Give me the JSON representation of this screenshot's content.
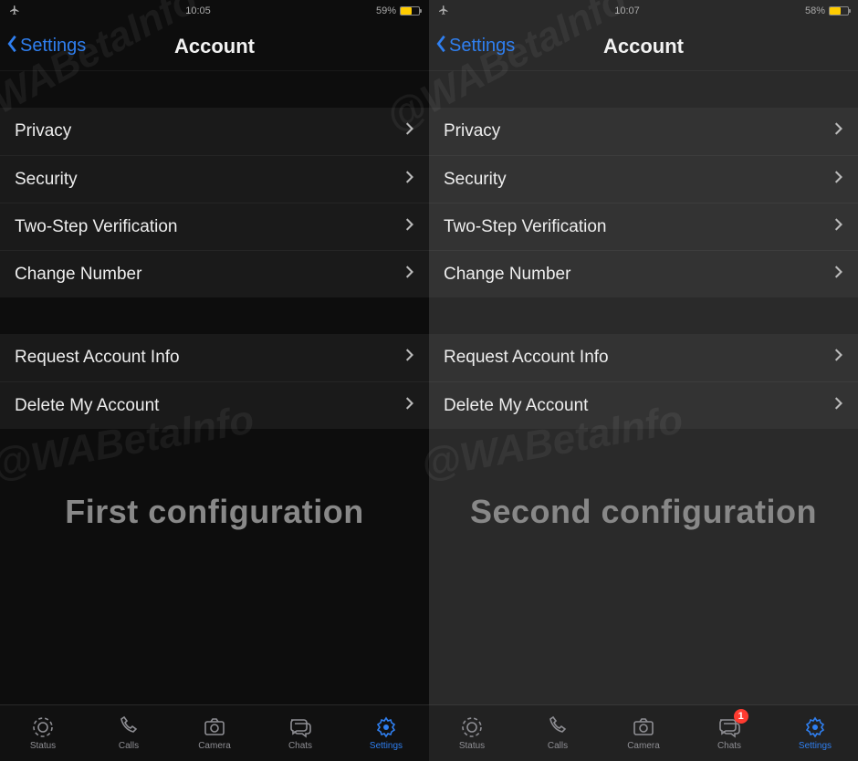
{
  "watermark": "@WABetaInfo",
  "screens": [
    {
      "bgClass": "bg-dark",
      "status": {
        "time": "10:05",
        "battery_pct": "59%",
        "battery_fill": "59%"
      },
      "nav": {
        "back": "Settings",
        "title": "Account"
      },
      "group1": [
        {
          "label": "Privacy"
        },
        {
          "label": "Security"
        },
        {
          "label": "Two-Step Verification"
        },
        {
          "label": "Change Number"
        }
      ],
      "group2": [
        {
          "label": "Request Account Info"
        },
        {
          "label": "Delete My Account"
        }
      ],
      "caption": "First configuration",
      "tabs": [
        {
          "name": "status",
          "label": "Status",
          "icon": "status-icon",
          "active": false,
          "badge": null
        },
        {
          "name": "calls",
          "label": "Calls",
          "icon": "phone-icon",
          "active": false,
          "badge": null
        },
        {
          "name": "camera",
          "label": "Camera",
          "icon": "camera-icon",
          "active": false,
          "badge": null
        },
        {
          "name": "chats",
          "label": "Chats",
          "icon": "chats-icon",
          "active": false,
          "badge": null
        },
        {
          "name": "settings",
          "label": "Settings",
          "icon": "settings-icon",
          "active": true,
          "badge": null
        }
      ]
    },
    {
      "bgClass": "bg-gray",
      "status": {
        "time": "10:07",
        "battery_pct": "58%",
        "battery_fill": "58%"
      },
      "nav": {
        "back": "Settings",
        "title": "Account"
      },
      "group1": [
        {
          "label": "Privacy"
        },
        {
          "label": "Security"
        },
        {
          "label": "Two-Step Verification"
        },
        {
          "label": "Change Number"
        }
      ],
      "group2": [
        {
          "label": "Request Account Info"
        },
        {
          "label": "Delete My Account"
        }
      ],
      "caption": "Second configuration",
      "tabs": [
        {
          "name": "status",
          "label": "Status",
          "icon": "status-icon",
          "active": false,
          "badge": null
        },
        {
          "name": "calls",
          "label": "Calls",
          "icon": "phone-icon",
          "active": false,
          "badge": null
        },
        {
          "name": "camera",
          "label": "Camera",
          "icon": "camera-icon",
          "active": false,
          "badge": null
        },
        {
          "name": "chats",
          "label": "Chats",
          "icon": "chats-icon",
          "active": false,
          "badge": "1"
        },
        {
          "name": "settings",
          "label": "Settings",
          "icon": "settings-icon",
          "active": true,
          "badge": null
        }
      ]
    }
  ]
}
